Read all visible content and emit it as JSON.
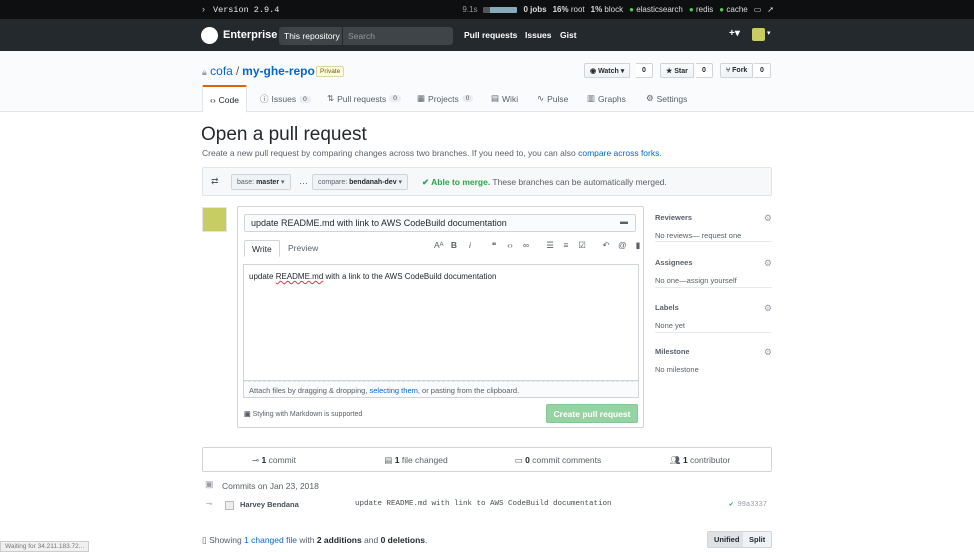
{
  "devbar": {
    "version": "Version 2.9.4",
    "time": "9.1s",
    "jobs": "0 jobs",
    "root_pct": "16%",
    "root_label": "root",
    "block_pct": "1%",
    "block_label": "block",
    "services": [
      "elasticsearch",
      "redis",
      "cache"
    ]
  },
  "header": {
    "brand": "Enterprise",
    "scope": "This repository",
    "search_placeholder": "Search",
    "nav": [
      "Pull requests",
      "Issues",
      "Gist"
    ],
    "plus": "+▾"
  },
  "repo": {
    "owner": "cofa",
    "sep": "/",
    "name": "my-ghe-repo",
    "visibility": "Private",
    "watch_label": "Watch ▾",
    "watch_count": "0",
    "star_label": "Star",
    "star_count": "0",
    "fork_label": "Fork",
    "fork_count": "0",
    "tabs": [
      {
        "label": "Code"
      },
      {
        "label": "Issues",
        "count": "0"
      },
      {
        "label": "Pull requests",
        "count": "0"
      },
      {
        "label": "Projects",
        "count": "0"
      },
      {
        "label": "Wiki"
      },
      {
        "label": "Pulse"
      },
      {
        "label": "Graphs"
      },
      {
        "label": "Settings"
      }
    ]
  },
  "page": {
    "title": "Open a pull request",
    "subtitle": "Create a new pull request by comparing changes across two branches. If you need to, you can also ",
    "subtitle_link": "compare across forks."
  },
  "range": {
    "base_label": "base:",
    "base_value": "master",
    "ellipsis": "…",
    "compare_label": "compare:",
    "compare_value": "bendanah-dev",
    "merge_status": "✔ Able to merge.",
    "merge_note": " These branches can be automatically merged."
  },
  "form": {
    "title_value": "update README.md with link to AWS CodeBuild documentation",
    "tab_write": "Write",
    "tab_preview": "Preview",
    "body_prefix": "update ",
    "body_flagged": "README.md",
    "body_suffix": " with a link to the AWS CodeBuild documentation",
    "attach_prefix": "Attach files by dragging & dropping, ",
    "attach_link": "selecting them",
    "attach_suffix": ", or pasting from the clipboard.",
    "markdown_note": "Styling with Markdown is supported",
    "submit": "Create pull request"
  },
  "sidebar": [
    {
      "heading": "Reviewers",
      "value": "No reviews— request one"
    },
    {
      "heading": "Assignees",
      "value": "No one—assign yourself"
    },
    {
      "heading": "Labels",
      "value": "None yet"
    },
    {
      "heading": "Milestone",
      "value": "No milestone"
    }
  ],
  "summary": {
    "commits_n": "1",
    "commits_label": " commit",
    "files_n": "1",
    "files_label": " file changed",
    "comments_n": "0",
    "comments_label": " commit comments",
    "contrib_n": "1",
    "contrib_label": " contributor"
  },
  "commits": {
    "date_heading": "Commits on Jan 23, 2018",
    "author": "Harvey Bendana",
    "message": "update README.md with link to AWS CodeBuild documentation",
    "sha": "99a3337"
  },
  "diff": {
    "prefix": "Showing ",
    "link": "1 changed file",
    "mid": " with ",
    "adds": "2 additions",
    "and": " and ",
    "dels": "0 deletions",
    "end": ".",
    "unified": "Unified",
    "split": "Split"
  },
  "statusbar": "Waiting for 34.211.183.72..."
}
